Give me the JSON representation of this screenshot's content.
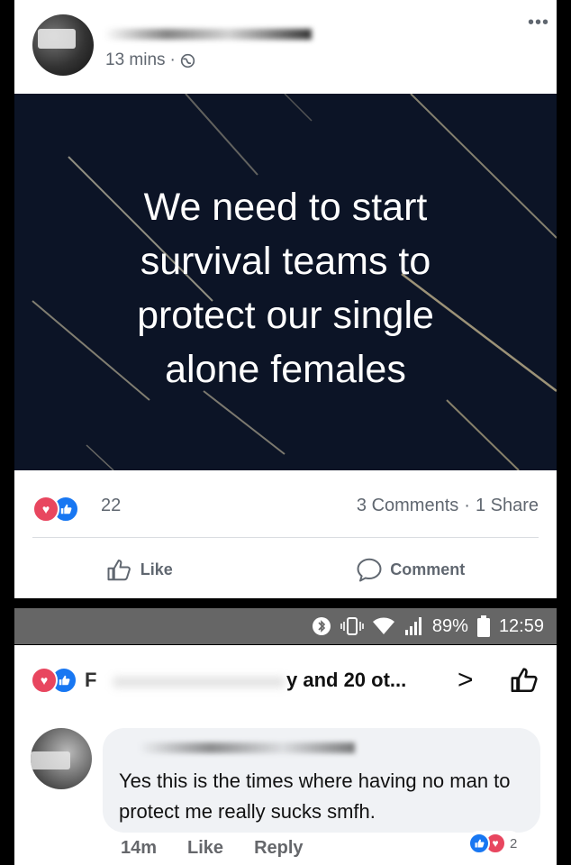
{
  "post": {
    "author_tail": "\"\"\"\"\"",
    "time": "13 mins",
    "separator": "·",
    "banner_lines": [
      "We need to start",
      "survival teams to",
      "protect our single",
      "alone females"
    ],
    "reaction_count": "22",
    "comments": "3 Comments",
    "dot": "·",
    "shares": "1 Share",
    "like_label": "Like",
    "comment_label": "Comment"
  },
  "status_bar": {
    "battery": "89%",
    "time": "12:59"
  },
  "comment_screen": {
    "reactors_initial": "F",
    "reactors_text": "y and 20 ot...",
    "comment_text": "Yes this is the times where having no man to protect me really sucks smfh.",
    "time": "14m",
    "like_label": "Like",
    "reply_label": "Reply",
    "reaction_count": "2"
  },
  "colors": {
    "like_blue": "#1877f2",
    "love_red": "#e8465f",
    "banner_bg": "#0c1426"
  }
}
